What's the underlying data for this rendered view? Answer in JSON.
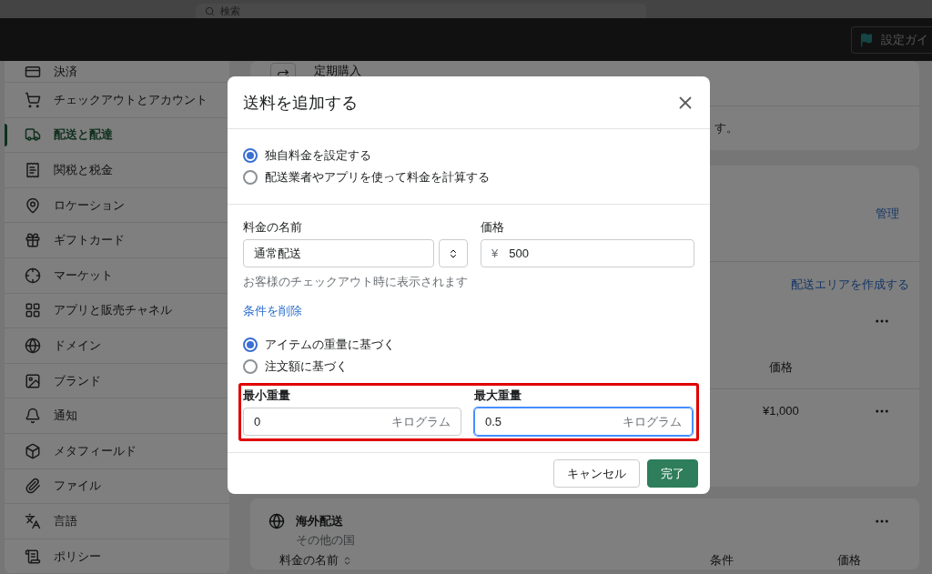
{
  "search": {
    "placeholder": "検索"
  },
  "topbar": {
    "guide_button": "設定ガイ"
  },
  "sidebar": {
    "items": [
      {
        "label": "決済",
        "selected": false
      },
      {
        "label": "チェックアウトとアカウント",
        "selected": false
      },
      {
        "label": "配送と配達",
        "selected": true
      },
      {
        "label": "関税と税金",
        "selected": false
      },
      {
        "label": "ロケーション",
        "selected": false
      },
      {
        "label": "ギフトカード",
        "selected": false
      },
      {
        "label": "マーケット",
        "selected": false
      },
      {
        "label": "アプリと販売チャネル",
        "selected": false
      },
      {
        "label": "ドメイン",
        "selected": false
      },
      {
        "label": "ブランド",
        "selected": false
      },
      {
        "label": "通知",
        "selected": false
      },
      {
        "label": "メタフィールド",
        "selected": false
      },
      {
        "label": "ファイル",
        "selected": false
      },
      {
        "label": "言語",
        "selected": false
      },
      {
        "label": "ポリシー",
        "selected": false
      }
    ]
  },
  "subscription_card": {
    "title": "定期購入",
    "text": "す。"
  },
  "shipping_card": {
    "manage_link": "管理",
    "create_zone_link": "配送エリアを作成する",
    "price_header": "価格",
    "row_price": "¥1,000"
  },
  "international_card": {
    "title": "海外配送",
    "subtitle": "その他の国",
    "columns": [
      "料金の名前",
      "条件",
      "価格"
    ]
  },
  "dialog": {
    "title": "送料を追加する",
    "rate_types": [
      {
        "label": "独自料金を設定する",
        "selected": true
      },
      {
        "label": "配送業者やアプリを使って料金を計算する",
        "selected": false
      }
    ],
    "name_label": "料金の名前",
    "name_value": "通常配送",
    "price_label": "価格",
    "currency": "¥",
    "price_value": "500",
    "help": "お客様のチェックアウト時に表示されます",
    "remove_link": "条件を削除",
    "conditions": [
      {
        "label": "アイテムの重量に基づく",
        "selected": true
      },
      {
        "label": "注文額に基づく",
        "selected": false
      }
    ],
    "weight": {
      "highlighted": true,
      "fields": [
        {
          "label": "最小重量",
          "value": "0",
          "unit": "キログラム",
          "focused": false
        },
        {
          "label": "最大重量",
          "value": "0.5",
          "unit": "キログラム",
          "focused": true
        }
      ]
    },
    "buttons": {
      "cancel": "キャンセル",
      "done": "完了"
    }
  }
}
